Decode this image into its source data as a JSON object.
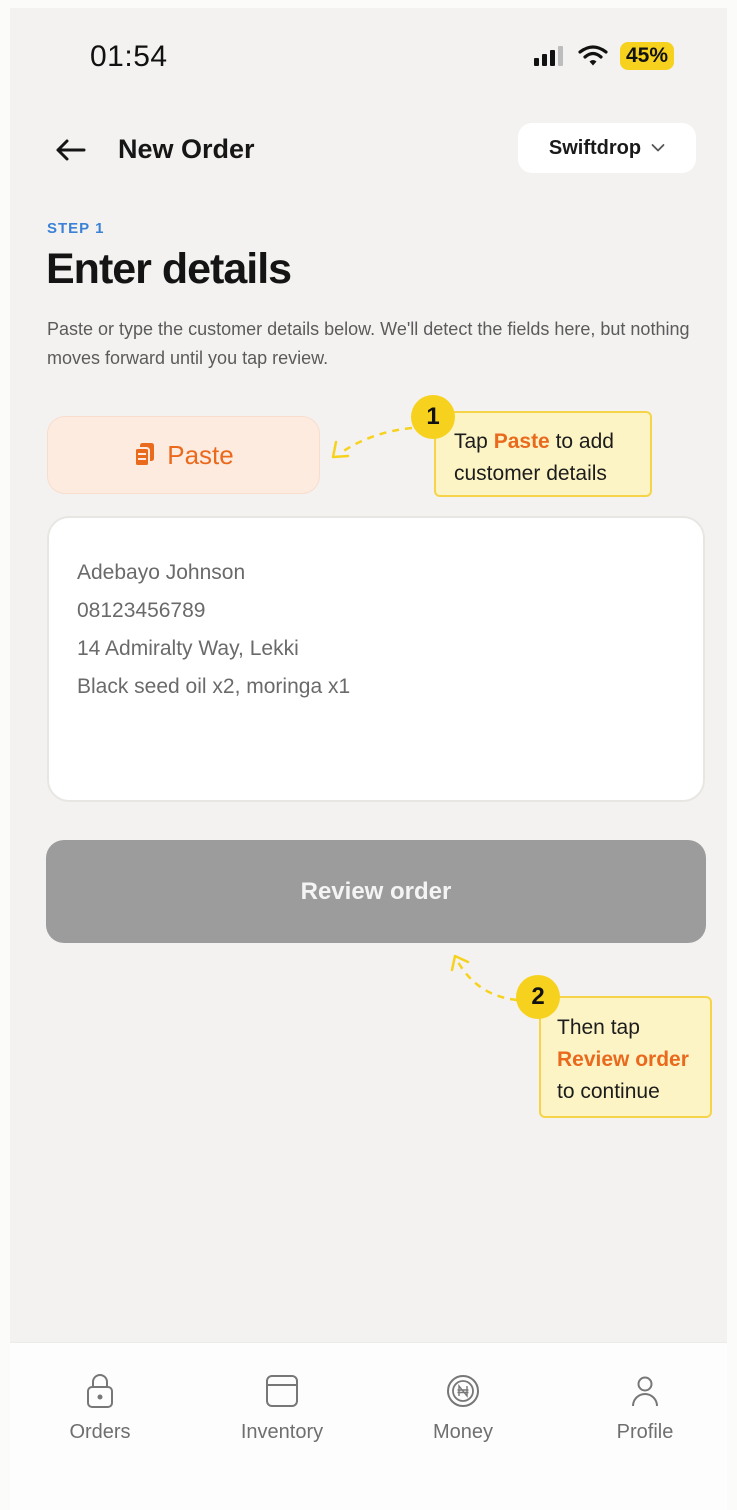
{
  "status_bar": {
    "time": "01:54",
    "battery": "45%",
    "icons": [
      "signal-icon",
      "wifi-icon"
    ]
  },
  "header": {
    "title": "New Order",
    "back_icon": "arrow-left-icon",
    "store_select": "Swiftdrop"
  },
  "step": {
    "label": "STEP 1",
    "heading": "Enter details",
    "description": "Paste or type the customer details below. We'll detect the fields here, but nothing moves forward until you tap review."
  },
  "paste_button": {
    "label": "Paste",
    "icon": "clipboard-icon"
  },
  "details_box": {
    "lines": [
      "Adebayo Johnson",
      "08123456789",
      "14 Admiralty Way, Lekki",
      "Black seed oil x2, moringa x1"
    ]
  },
  "review_button": {
    "label": "Review order"
  },
  "tips": [
    {
      "number": "1",
      "before": "Tap ",
      "highlight": "Paste",
      "after": " to add customer details"
    },
    {
      "number": "2",
      "before": "Then tap ",
      "highlight": "Review order",
      "after": " to continue"
    }
  ],
  "bottom_nav": {
    "items": [
      {
        "label": "Orders",
        "icon": "lock-bag-icon"
      },
      {
        "label": "Inventory",
        "icon": "box-icon"
      },
      {
        "label": "Money",
        "icon": "naira-coin-icon"
      },
      {
        "label": "Profile",
        "icon": "user-icon"
      }
    ]
  },
  "colors": {
    "accent_orange": "#ea6a1d",
    "step_blue": "#3b82d6",
    "tip_yellow": "#f6d21f",
    "button_disabled": "#9c9c9c"
  }
}
